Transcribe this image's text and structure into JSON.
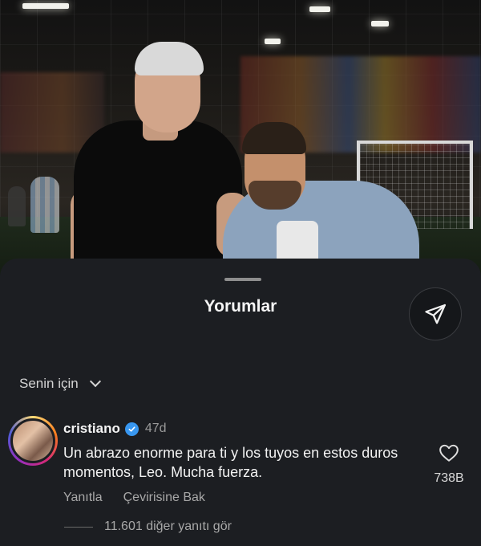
{
  "sheet": {
    "title": "Yorumlar",
    "filter_label": "Senin için"
  },
  "comment": {
    "username": "cristiano",
    "verified": true,
    "time": "47d",
    "text": "Un abrazo enorme para ti y los tuyos en estos duros momentos, Leo. Mucha fuerza.",
    "like_count": "738B",
    "reply_label": "Yanıtla",
    "translate_label": "Çevirisine Bak",
    "view_replies": "11.601 diğer yanıtı gör"
  },
  "icons": {
    "share": "paper-plane-icon",
    "filter": "chevron-down-icon",
    "like": "heart-icon",
    "verified": "verified-badge-icon"
  },
  "colors": {
    "sheet_bg": "#1c1e22",
    "verified_blue": "#3897f0",
    "text_primary": "#f5f5f5",
    "text_secondary": "#a8a8a8"
  }
}
